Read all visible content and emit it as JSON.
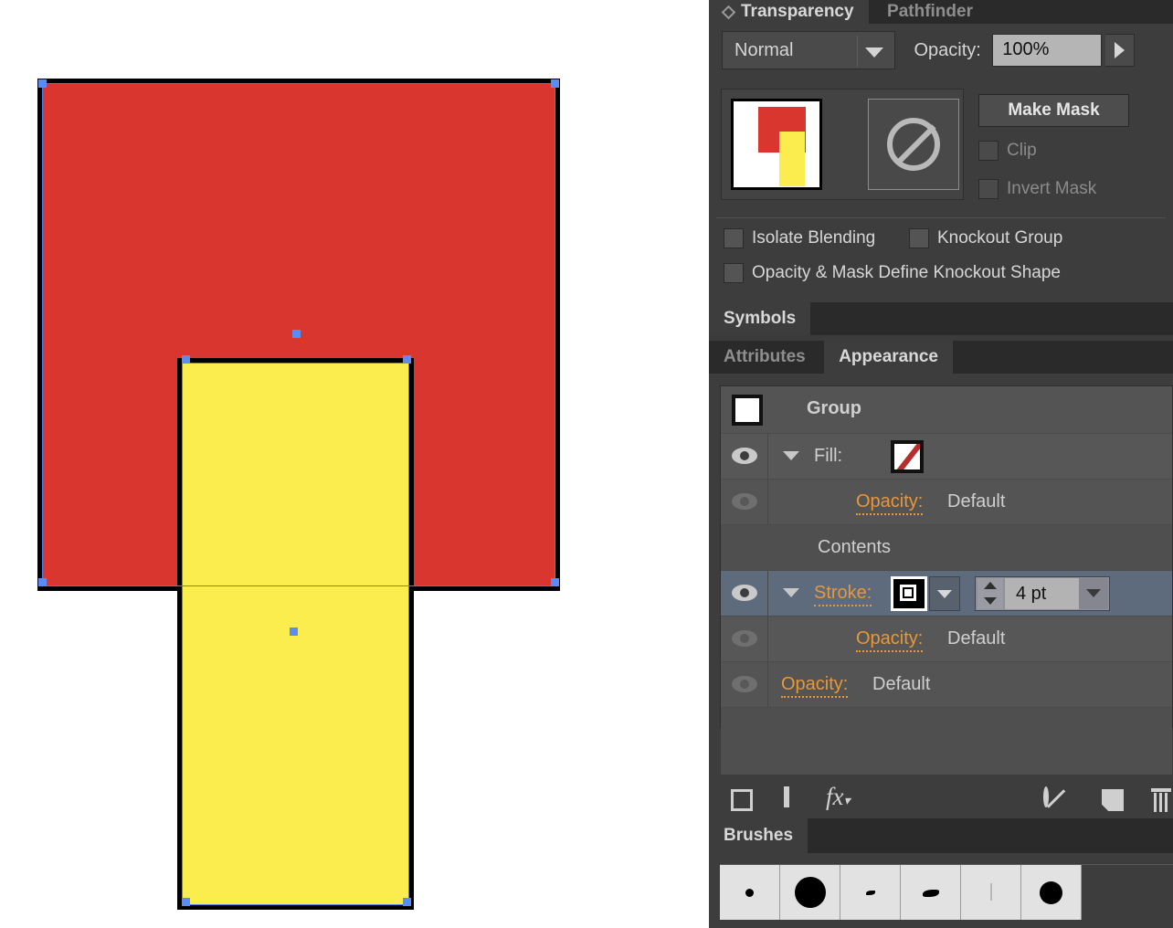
{
  "app": "Adobe Illustrator",
  "canvas": {
    "shapes": [
      {
        "name": "red-rectangle",
        "fill": "#d93630",
        "stroke": "#000000",
        "selected": true
      },
      {
        "name": "yellow-rectangle",
        "fill": "#fced4e",
        "stroke": "#000000",
        "selected": true
      }
    ],
    "selection_color": "#5b8cf5"
  },
  "transparency_panel": {
    "tabs": [
      {
        "label": "Transparency",
        "active": true
      },
      {
        "label": "Pathfinder",
        "active": false
      }
    ],
    "blend_mode": "Normal",
    "opacity_label": "Opacity:",
    "opacity_value": "100%",
    "make_mask_label": "Make Mask",
    "checkboxes": [
      {
        "label": "Clip",
        "checked": false,
        "enabled": false
      },
      {
        "label": "Invert Mask",
        "checked": false,
        "enabled": false
      },
      {
        "label": "Isolate Blending",
        "checked": false,
        "enabled": true
      },
      {
        "label": "Knockout Group",
        "checked": false,
        "enabled": true
      },
      {
        "label": "Opacity & Mask Define Knockout Shape",
        "checked": false,
        "enabled": true
      }
    ]
  },
  "symbols_panel": {
    "tabs": [
      {
        "label": "Symbols",
        "active": true
      }
    ]
  },
  "appearance_panel": {
    "tabs": [
      {
        "label": "Attributes",
        "active": false
      },
      {
        "label": "Appearance",
        "active": true
      }
    ],
    "rows": [
      {
        "name": "group",
        "label": "Group",
        "type": "header"
      },
      {
        "name": "fill",
        "label": "Fill:",
        "type": "fill",
        "visible": true,
        "expanded": true
      },
      {
        "name": "fill-opacity",
        "label_key": "Opacity:",
        "value": "Default",
        "type": "opacity",
        "visible": false
      },
      {
        "name": "contents",
        "label": "Contents",
        "type": "contents"
      },
      {
        "name": "stroke",
        "label": "Stroke:",
        "type": "stroke",
        "visible": true,
        "expanded": true,
        "weight": "4 pt",
        "selected": true
      },
      {
        "name": "stroke-opacity",
        "label_key": "Opacity:",
        "value": "Default",
        "type": "opacity",
        "visible": false
      },
      {
        "name": "group-opacity",
        "label_key": "Opacity:",
        "value": "Default",
        "type": "opacity",
        "visible": false
      }
    ],
    "opacity_key": "Opacity:",
    "opacity_value": "Default",
    "contents_label": "Contents",
    "stroke_weight": "4 pt",
    "toolbar_icons": [
      "add-new-stroke-icon",
      "add-new-fill-icon",
      "add-new-effect-icon",
      "clear-appearance-icon",
      "duplicate-item-icon",
      "delete-item-icon"
    ]
  },
  "brushes_panel": {
    "tabs": [
      {
        "label": "Brushes",
        "active": true
      }
    ],
    "brushes": [
      "small-round-brush",
      "large-round-brush",
      "tiny-tapered-brush",
      "oval-tapered-brush",
      "thin-line-brush",
      "medium-round-brush"
    ]
  },
  "colors": {
    "red": "#d93630",
    "yellow": "#fced4e",
    "orange_accent": "#e8973a",
    "selection_blue": "#5b8cf5",
    "row_selected": "#5e6b7d",
    "panel_bg": "#3d3d3d"
  }
}
